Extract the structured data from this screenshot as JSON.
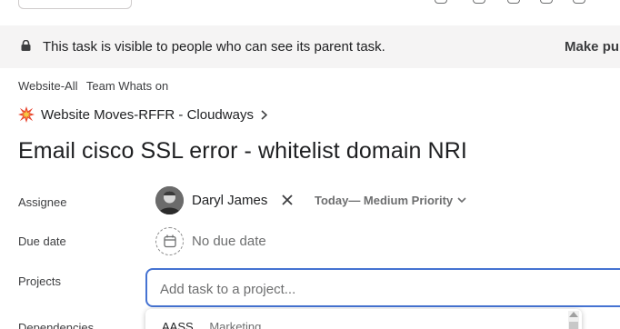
{
  "banner": {
    "message": "This task is visible to people who can see its parent task.",
    "action_label": "Make pu"
  },
  "breadcrumbs": [
    "Website-All",
    "Team Whats on"
  ],
  "parent_task": {
    "emoji_icon": "collision-icon",
    "label": "Website Moves-RFFR - Cloudways"
  },
  "task": {
    "title": "Email cisco SSL error - whitelist domain NRI"
  },
  "fields": {
    "assignee_label": "Assignee",
    "assignee_name": "Daryl James",
    "priority_text": "Today— Medium Priority",
    "due_label": "Due date",
    "due_value": "No due date",
    "projects_label": "Projects",
    "projects_placeholder": "Add task to a project...",
    "dependencies_label": "Dependencies"
  },
  "project_suggestions": [
    {
      "name": "AASS",
      "team": "Marketing"
    }
  ],
  "colors": {
    "accent_blue": "#4573d2",
    "banner_bg": "#f5f4f4",
    "text_primary": "#1e1f21",
    "text_secondary": "#6d6e6f"
  }
}
